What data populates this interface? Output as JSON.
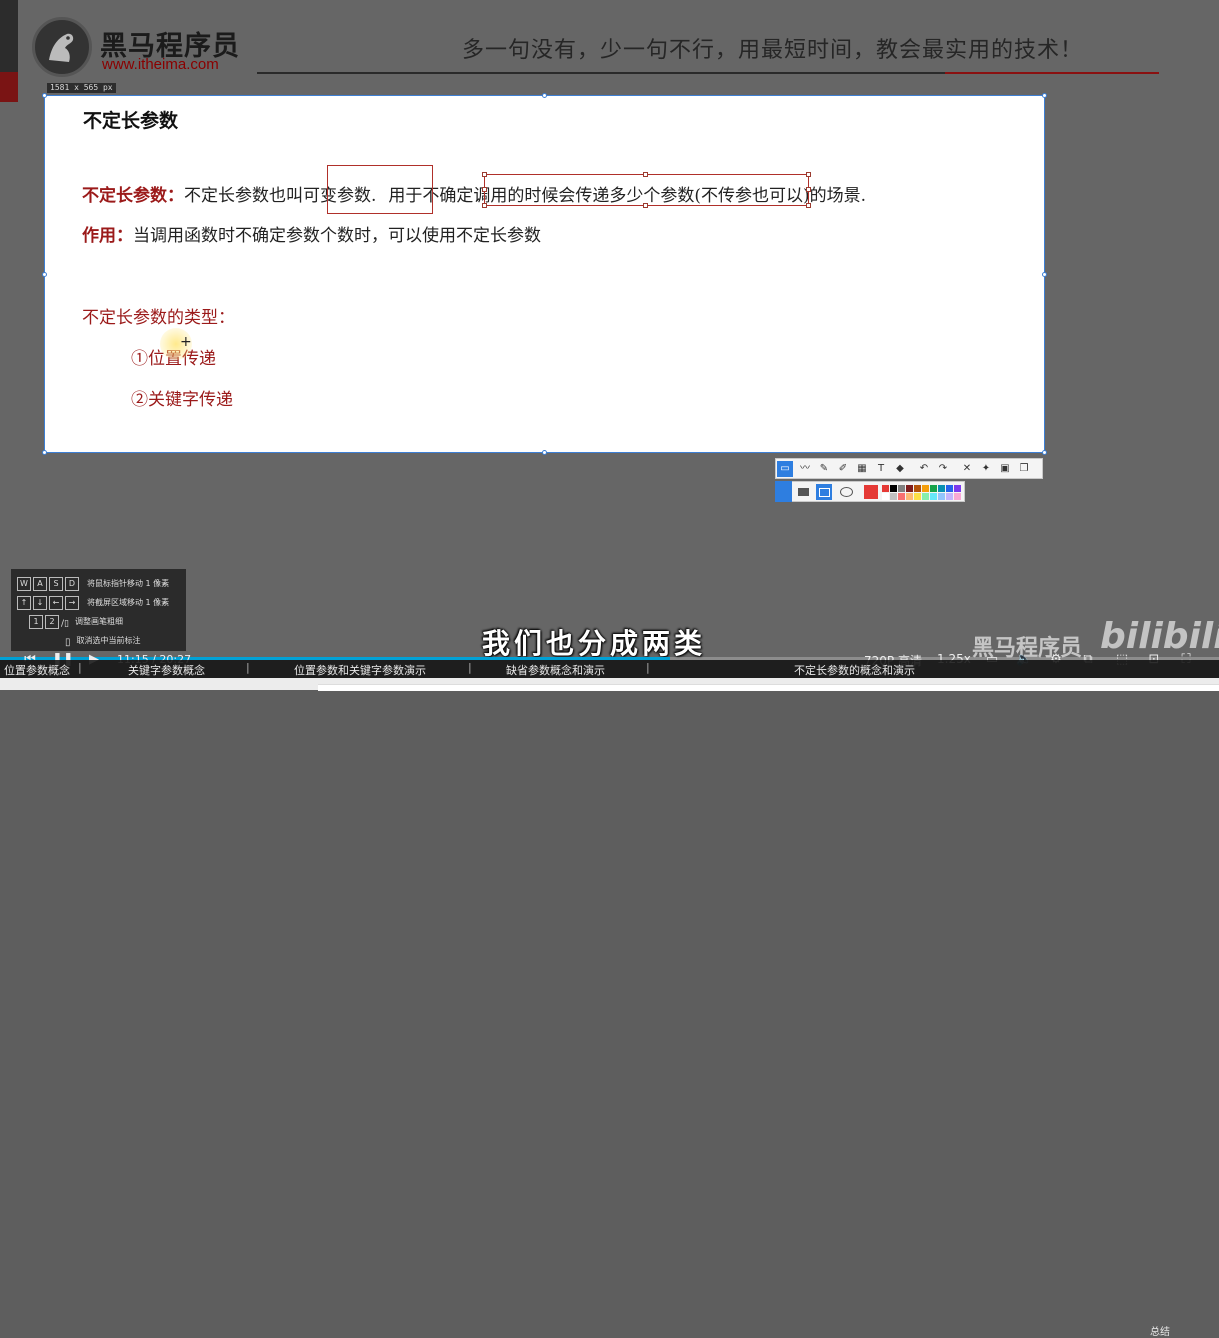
{
  "header": {
    "logo_text": "黑马程序员",
    "logo_url": "www.itheima.com",
    "slogan": "多一句没有，少一句不行，用最短时间，教会最实用的技术！"
  },
  "selection": {
    "dimension_label": "1581 x 565  px"
  },
  "slide": {
    "title": "不定长参数",
    "definition_label": "不定长参数：",
    "definition_text_a": "不定长参数也",
    "definition_boxed_1": "叫可变参数.",
    "definition_text_b": "用于",
    "definition_boxed_2": "不确定调用的时候会传递多少个参数",
    "definition_text_c": "(不传参也可以)的场景.",
    "usage_label": "作用：",
    "usage_text": "当调用函数时不确定参数个数时，可以使用不定长参数",
    "types_heading": "不定长参数的类型：",
    "type_1": "①位置传递",
    "type_2": "②关键字传递"
  },
  "annotation_toolbar": {
    "tools": [
      "rect-select",
      "line",
      "pen",
      "marker",
      "mosaic",
      "T",
      "eraser",
      "undo",
      "redo",
      "close",
      "pin",
      "save",
      "copy"
    ],
    "swatch_colors": [
      "#e53935",
      "#000000",
      "#808080",
      "#7f1d1d",
      "#b45309",
      "#f59e0b",
      "#16a34a",
      "#0891b2",
      "#2563eb",
      "#7c3aed",
      "#ffffff",
      "#c0c0c0",
      "#f87171",
      "#fdba74",
      "#fde047",
      "#86efac",
      "#67e8f9",
      "#93c5fd",
      "#c4b5fd",
      "#f9a8d4"
    ]
  },
  "keyboard_hints": {
    "row1_keys": [
      "W",
      "A",
      "S",
      "D"
    ],
    "row1_text": "将鼠标指针移动 1 像素",
    "row2_keys": [
      "↑",
      "↓",
      "←",
      "→"
    ],
    "row2_text": "将截屏区域移动 1 像素",
    "row3_keys": [
      "1",
      "2"
    ],
    "row3_text": "调整画笔粗细",
    "row4_text": "取消选中当前标注"
  },
  "subtitle": "我们也分成两类",
  "watermark": {
    "brand": "黑马程序员",
    "site": "bilibili"
  },
  "player": {
    "time": "11:15 / 20:27",
    "quality": "720P 高清",
    "speed": "1.25x",
    "progress_fraction": 0.55,
    "chapters": [
      "位置参数概念",
      "关键字参数概念",
      "位置参数和关键字参数演示",
      "缺省参数概念和演示",
      "不定长参数的概念和演示"
    ],
    "summary": "总结"
  }
}
